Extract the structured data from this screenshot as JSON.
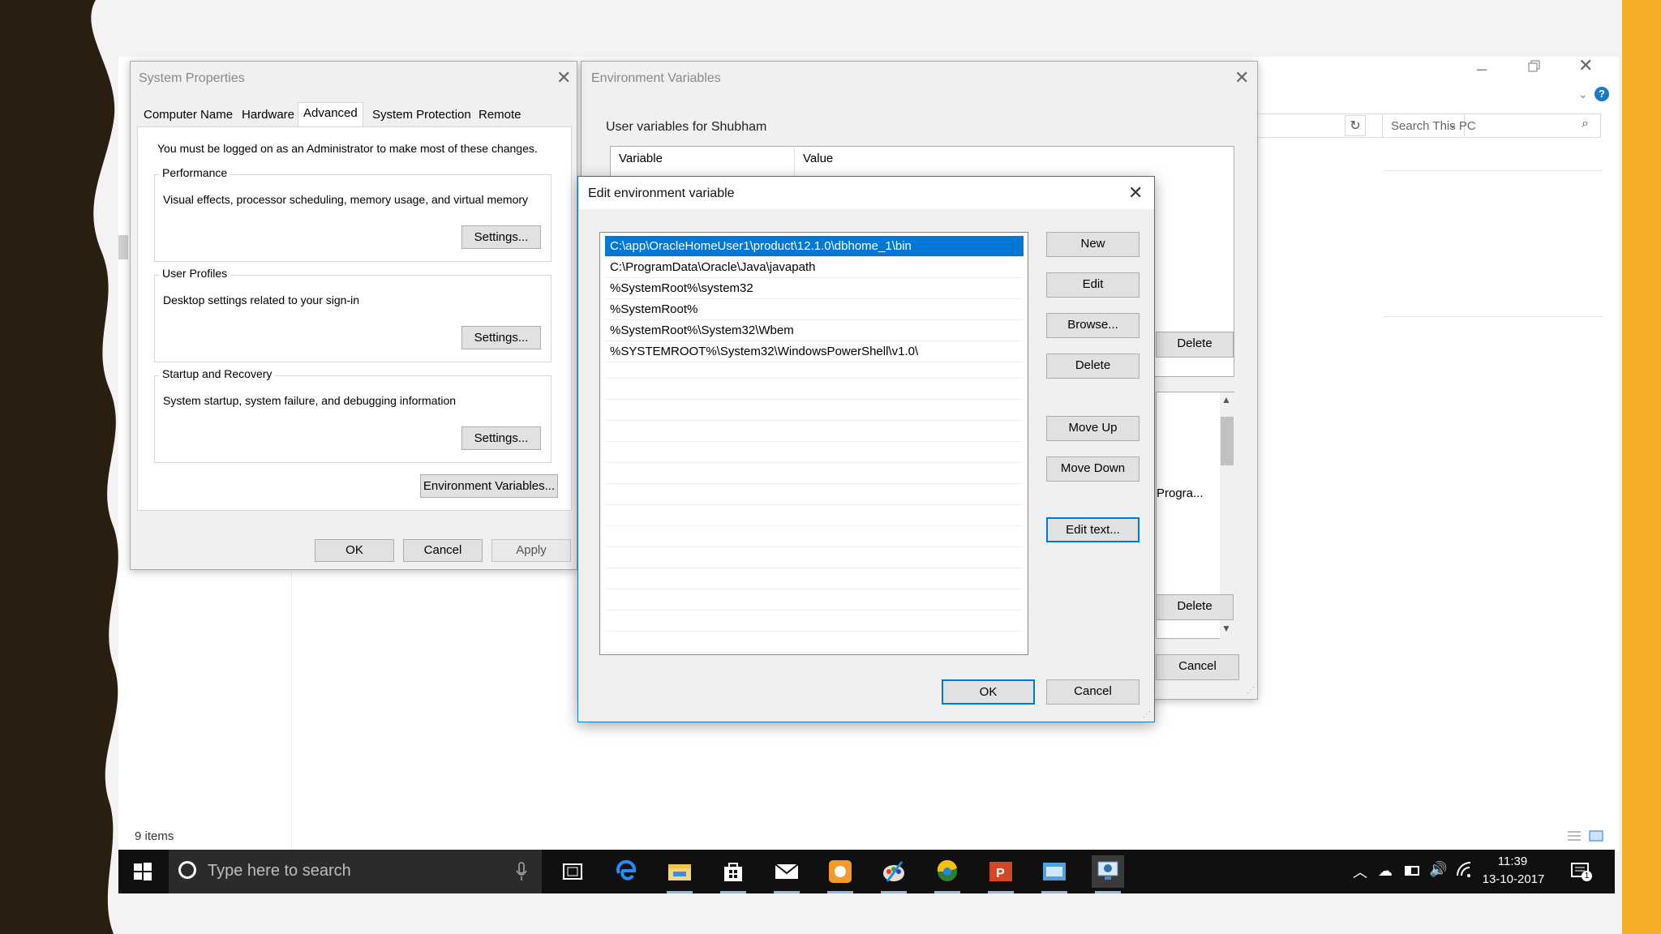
{
  "colors": {
    "frame_left": "#2a1e10",
    "frame_right": "#f6ad2a",
    "selection": "#0078d7",
    "taskbar": "#101010"
  },
  "explorer": {
    "search_placeholder": "Search This PC",
    "status_items": "9 items",
    "partial_texts": {
      "delete_top": "Delete",
      "progra": "Progra...",
      "delete_bottom": "Delete",
      "cancel": "Cancel"
    }
  },
  "system_properties": {
    "title": "System Properties",
    "tabs": [
      "Computer Name",
      "Hardware",
      "Advanced",
      "System Protection",
      "Remote"
    ],
    "active_tab": "Advanced",
    "admin_note": "You must be logged on as an Administrator to make most of these changes.",
    "performance": {
      "label": "Performance",
      "desc": "Visual effects, processor scheduling, memory usage, and virtual memory",
      "button": "Settings..."
    },
    "user_profiles": {
      "label": "User Profiles",
      "desc": "Desktop settings related to your sign-in",
      "button": "Settings..."
    },
    "startup": {
      "label": "Startup and Recovery",
      "desc": "System startup, system failure, and debugging information",
      "button": "Settings..."
    },
    "env_button": "Environment Variables...",
    "ok": "OK",
    "cancel": "Cancel",
    "apply": "Apply"
  },
  "env_vars": {
    "title": "Environment Variables",
    "user_vars_label": "User variables for Shubham",
    "col_variable": "Variable",
    "col_value": "Value"
  },
  "edit_env": {
    "title": "Edit environment variable",
    "entries": [
      "C:\\app\\OracleHomeUser1\\product\\12.1.0\\dbhome_1\\bin",
      "C:\\ProgramData\\Oracle\\Java\\javapath",
      "%SystemRoot%\\system32",
      "%SystemRoot%",
      "%SystemRoot%\\System32\\Wbem",
      "%SYSTEMROOT%\\System32\\WindowsPowerShell\\v1.0\\"
    ],
    "selected_index": 0,
    "buttons": {
      "new": "New",
      "edit": "Edit",
      "browse": "Browse...",
      "delete": "Delete",
      "move_up": "Move Up",
      "move_down": "Move Down",
      "edit_text": "Edit text..."
    },
    "ok": "OK",
    "cancel": "Cancel"
  },
  "taskbar": {
    "search_placeholder": "Type here to search",
    "time": "11:39",
    "date": "13-10-2017",
    "notification_count": "1",
    "icons": [
      "task-view-icon",
      "edge-icon",
      "file-explorer-icon",
      "store-icon",
      "mail-icon",
      "app-orange-icon",
      "paint-icon",
      "browser-icon",
      "powerpoint-icon",
      "control-panel-icon",
      "system-icon"
    ]
  }
}
